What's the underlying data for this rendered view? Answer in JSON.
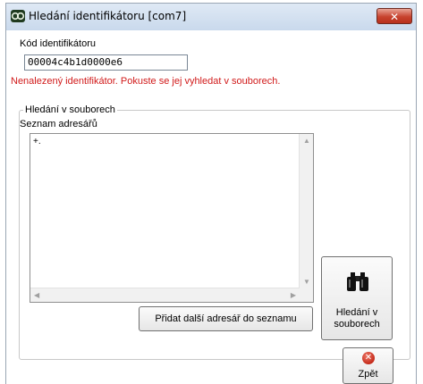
{
  "window": {
    "title": "Hledání identifikátoru [com7]",
    "close_label": "✕"
  },
  "identifier": {
    "label": "Kód identifikátoru",
    "value": "00004c4b1d0000e6"
  },
  "warning_text": "Nenalezený identifikátor. Pokuste se jej vyhledat v souborech.",
  "file_search": {
    "group_label": "Hledání v souborech",
    "list_label": "Seznam adresářů",
    "list_items": [
      "+."
    ],
    "add_button_label": "Přidat další adresář do seznamu",
    "search_button_label_line1": "Hledání v",
    "search_button_label_line2": "souborech",
    "search_icon": "binoculars-icon"
  },
  "back_button": {
    "label": "Zpět",
    "icon": "close-circle-icon"
  },
  "colors": {
    "warning": "#d11a1a",
    "close_button": "#c7432e"
  }
}
